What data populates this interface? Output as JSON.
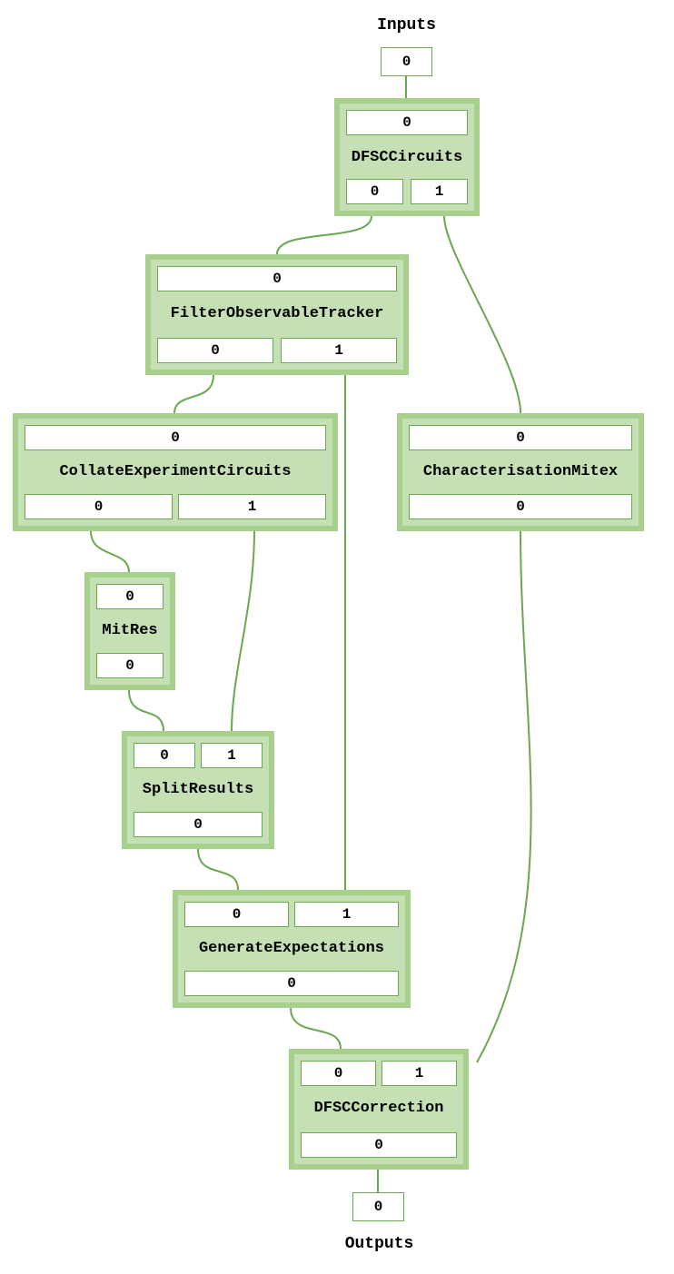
{
  "inputs_label": "Inputs",
  "outputs_label": "Outputs",
  "input_port": "0",
  "output_port": "0",
  "nodes": {
    "dfsc_circuits": {
      "title": "DFSCCircuits",
      "in": [
        "0"
      ],
      "out": [
        "0",
        "1"
      ]
    },
    "filter_observable_tracker": {
      "title": "FilterObservableTracker",
      "in": [
        "0"
      ],
      "out": [
        "0",
        "1"
      ]
    },
    "collate_experiment_circuits": {
      "title": "CollateExperimentCircuits",
      "in": [
        "0"
      ],
      "out": [
        "0",
        "1"
      ]
    },
    "characterisation_mitex": {
      "title": "CharacterisationMitex",
      "in": [
        "0"
      ],
      "out": [
        "0"
      ]
    },
    "mitres": {
      "title": "MitRes",
      "in": [
        "0"
      ],
      "out": [
        "0"
      ]
    },
    "split_results": {
      "title": "SplitResults",
      "in": [
        "0",
        "1"
      ],
      "out": [
        "0"
      ]
    },
    "generate_expectations": {
      "title": "GenerateExpectations",
      "in": [
        "0",
        "1"
      ],
      "out": [
        "0"
      ]
    },
    "dfsc_correction": {
      "title": "DFSCCorrection",
      "in": [
        "0",
        "1"
      ],
      "out": [
        "0"
      ]
    }
  }
}
